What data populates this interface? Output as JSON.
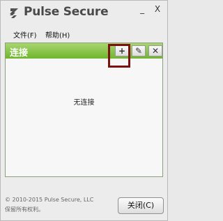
{
  "app": {
    "brand": "Pulse Secure"
  },
  "window_controls": {
    "minimize": "_",
    "close": "X"
  },
  "menu": {
    "items": [
      "文件(F)",
      "帮助(H)"
    ]
  },
  "panel": {
    "title": "连接",
    "buttons": {
      "add": "+",
      "edit": "✎",
      "delete": "✕"
    },
    "empty_message": "无连接"
  },
  "footer": {
    "copyright_line1": "© 2010-2015 Pulse Secure, LLC",
    "copyright_line2": "保留所有权利。",
    "close_label": "关闭(C)"
  },
  "colors": {
    "accent": "#7d1111",
    "panel_header_top": "#a8d66f",
    "panel_header_bottom": "#6fb52d",
    "logo": "#4f4f4f"
  },
  "icons": {
    "logo": "pulse-secure-logo-icon",
    "add": "plus-icon",
    "edit": "pencil-icon",
    "delete": "x-icon"
  }
}
